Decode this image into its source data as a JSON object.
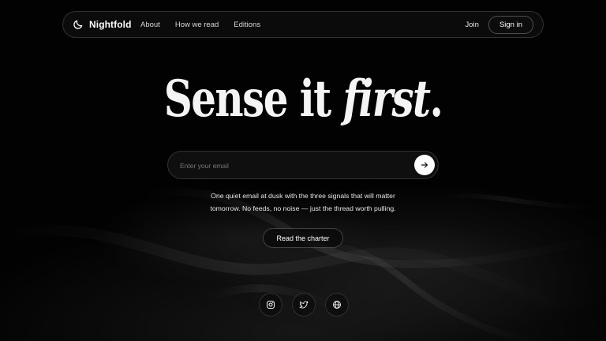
{
  "brand": {
    "name": "Nightfold",
    "icon": "moon-icon"
  },
  "nav": {
    "links": [
      {
        "label": "About"
      },
      {
        "label": "How we read"
      },
      {
        "label": "Editions"
      }
    ],
    "join_label": "Join",
    "signin_label": "Sign in"
  },
  "hero": {
    "headline_plain": "Sense it ",
    "headline_accent": "first",
    "headline_end": ".",
    "email_placeholder": "Enter your email",
    "submit_icon": "arrow-right-icon",
    "description_line1": "One quiet email at dusk with the three signals that will matter",
    "description_line2": "tomorrow. No feeds, no noise — just the thread worth pulling.",
    "cta_label": "Read the charter"
  },
  "socials": [
    {
      "icon": "instagram-icon"
    },
    {
      "icon": "twitter-icon"
    },
    {
      "icon": "globe-icon"
    }
  ],
  "colors": {
    "background": "#000000",
    "text": "#ffffff",
    "accent_button": "#ffffff"
  }
}
